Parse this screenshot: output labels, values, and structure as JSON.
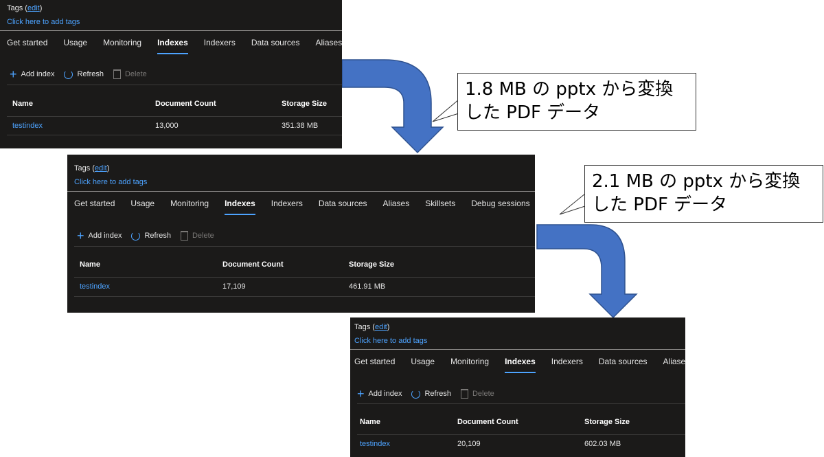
{
  "colors": {
    "panel_bg": "#1b1a19",
    "link": "#4da3ff",
    "arrow": "#4472c4"
  },
  "callouts": [
    {
      "text": "1.8 MB の pptx から変換\nした PDF データ"
    },
    {
      "text": "2.1 MB の pptx から変換\nした PDF データ"
    }
  ],
  "panels": [
    {
      "tags_label": "Tags (",
      "edit_label": "edit",
      "tags_close": ")",
      "add_tags": "Click here to add tags",
      "tabs": [
        "Get started",
        "Usage",
        "Monitoring",
        "Indexes",
        "Indexers",
        "Data sources",
        "Aliases"
      ],
      "active_tab": "Indexes",
      "toolbar": {
        "add": "Add index",
        "refresh": "Refresh",
        "delete": "Delete"
      },
      "columns": [
        "Name",
        "Document Count",
        "Storage Size"
      ],
      "rows": [
        {
          "name": "testindex",
          "count": "13,000",
          "size": "351.38 MB"
        }
      ]
    },
    {
      "tags_label": "Tags (",
      "edit_label": "edit",
      "tags_close": ")",
      "add_tags": "Click here to add tags",
      "tabs": [
        "Get started",
        "Usage",
        "Monitoring",
        "Indexes",
        "Indexers",
        "Data sources",
        "Aliases",
        "Skillsets",
        "Debug sessions"
      ],
      "active_tab": "Indexes",
      "toolbar": {
        "add": "Add index",
        "refresh": "Refresh",
        "delete": "Delete"
      },
      "columns": [
        "Name",
        "Document Count",
        "Storage Size"
      ],
      "rows": [
        {
          "name": "testindex",
          "count": "17,109",
          "size": "461.91 MB"
        }
      ]
    },
    {
      "tags_label": "Tags (",
      "edit_label": "edit",
      "tags_close": ")",
      "add_tags": "Click here to add tags",
      "tabs": [
        "Get started",
        "Usage",
        "Monitoring",
        "Indexes",
        "Indexers",
        "Data sources",
        "Aliases"
      ],
      "active_tab": "Indexes",
      "toolbar": {
        "add": "Add index",
        "refresh": "Refresh",
        "delete": "Delete"
      },
      "columns": [
        "Name",
        "Document Count",
        "Storage Size"
      ],
      "rows": [
        {
          "name": "testindex",
          "count": "20,109",
          "size": "602.03 MB"
        }
      ]
    }
  ]
}
